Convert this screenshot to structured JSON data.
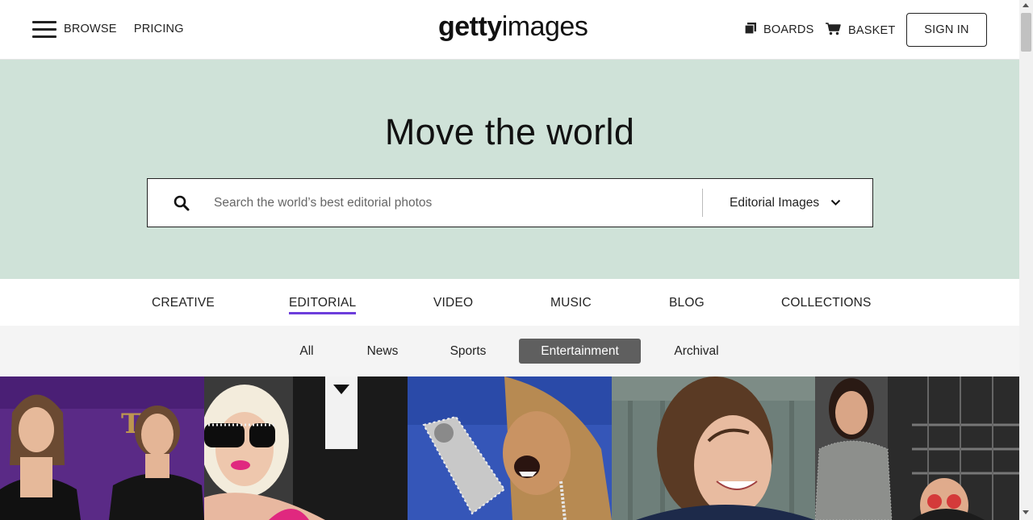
{
  "header": {
    "browse": "BROWSE",
    "pricing": "PRICING",
    "logo_bold": "getty",
    "logo_light": "images",
    "boards": "BOARDS",
    "basket": "BASKET",
    "sign_in": "SIGN IN"
  },
  "hero": {
    "title": "Move the world",
    "search_placeholder": "Search the world’s best editorial photos",
    "search_type": "Editorial Images",
    "background": "#cfe2d8"
  },
  "tabs": [
    "CREATIVE",
    "EDITORIAL",
    "VIDEO",
    "MUSIC",
    "BLOG",
    "COLLECTIONS"
  ],
  "active_tab": "EDITORIAL",
  "subtabs": [
    "All",
    "News",
    "Sports",
    "Entertainment",
    "Archival"
  ],
  "active_subtab": "Entertainment",
  "accent_color": "#6c3ddb",
  "photos": [
    {
      "subject": "two-women-mtv-awards-photo"
    },
    {
      "subject": "lady-gaga-sunglasses-photo"
    },
    {
      "subject": "singer-performing-microphone-photo"
    },
    {
      "subject": "woman-smiling-photo"
    },
    {
      "subject": "woman-sequin-dress-and-man-photo"
    }
  ]
}
